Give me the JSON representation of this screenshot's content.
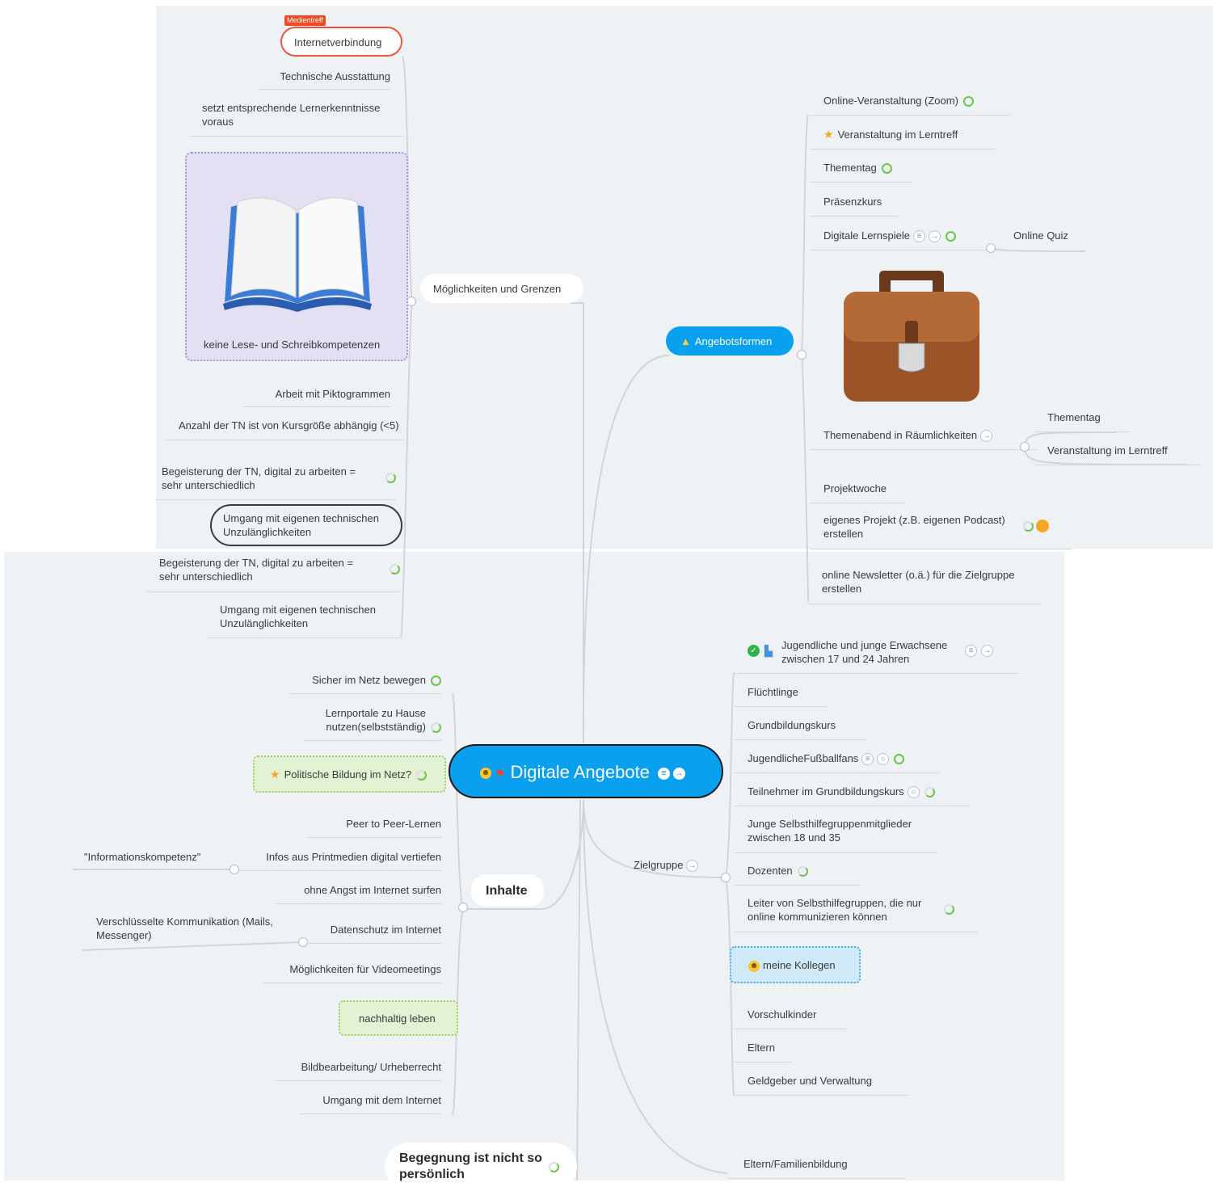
{
  "central": {
    "title": "Digitale Angebote"
  },
  "left": {
    "grenzen": {
      "label": "Möglichkeiten und Grenzen",
      "tag": "Medientreff",
      "items": [
        "Internetverbindung",
        "Technische Ausstattung",
        "setzt entsprechende Lernerkenntnisse voraus",
        "keine Lese- und Schreibkompetenzen",
        "Arbeit mit Piktogrammen",
        "Anzahl der TN ist von Kursgröße abhängig (<5)",
        "Begeisterung der TN, digital zu arbeiten = sehr unterschiedlich",
        "Umgang mit eigenen technischen Unzulänglichkeiten",
        "Begeisterung der TN, digital zu arbeiten = sehr unterschiedlich",
        "Umgang mit eigenen technischen Unzulänglichkeiten"
      ]
    },
    "inhalte": {
      "label": "Inhalte",
      "items": [
        "Sicher im Netz bewegen",
        "Lernportale zu Hause nutzen(selbstständig)",
        "Politische Bildung im Netz?",
        "Peer to Peer-Lernen",
        "Infos aus Printmedien digital vertiefen",
        "ohne Angst im Internet surfen",
        "Datenschutz im Internet",
        "Möglichkeiten für Videomeetings",
        "nachhaltig leben",
        "Bildbearbeitung/ Urheberrecht",
        "Umgang mit dem Internet"
      ],
      "sub_informationskompetenz": "\"Informationskompetenz\"",
      "sub_verschluesselt": "Verschlüsselte Kommunikation (Mails, Messenger)"
    },
    "begegnung": {
      "label": "Begegnung ist nicht so persönlich"
    }
  },
  "right": {
    "angebotsformen": {
      "label": "Angebotsformen",
      "items": [
        "Online-Veranstaltung (Zoom)",
        "Veranstaltung im Lerntreff",
        "Thementag",
        "Präsenzkurs",
        "Digitale Lernspiele",
        "Themenabend in Räumlichkeiten",
        "Projektwoche",
        "eigenes Projekt (z.B. eigenen Podcast) erstellen",
        "online Newsletter (o.ä.) für die Zielgruppe erstellen"
      ],
      "sub_quiz": "Online Quiz",
      "sub_thementag": "Thementag",
      "sub_lerntreff": "Veranstaltung im Lerntreff"
    },
    "zielgruppe": {
      "label": "Zielgruppe",
      "items": [
        "Jugendliche und junge Erwachsene zwischen 17 und 24 Jahren",
        "Flüchtlinge",
        "Grundbildungskurs",
        "JugendlicheFußballfans",
        "Teilnehmer im Grundbildungskurs",
        "Junge Selbsthilfegruppenmitglieder zwischen 18 und 35",
        "Dozenten",
        "Leiter von Selbsthilfegruppen, die nur online kommunizieren können",
        "meine Kollegen",
        "Vorschulkinder",
        "Eltern",
        "Geldgeber und Verwaltung"
      ]
    },
    "eltern_familie": {
      "label": "Eltern/Familienbildung"
    }
  },
  "colors": {
    "accent": "#0aa0f0",
    "wire": "#cfd5da",
    "canvas": "#eef2f5",
    "progress": "#6fc24a"
  }
}
